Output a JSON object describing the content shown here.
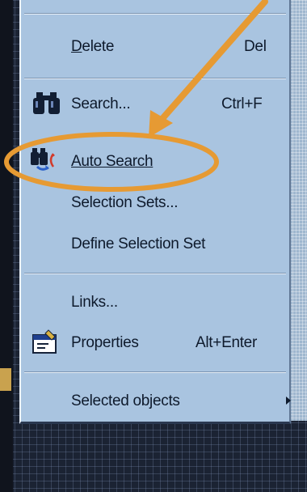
{
  "menu": {
    "items": [
      {
        "label_ul": "D",
        "label_rest": "elete",
        "shortcut": "Del"
      },
      {
        "label_ul": "",
        "label_rest": "Search...",
        "shortcut": "Ctrl+F",
        "icon": "binoculars-icon"
      },
      {
        "label_ul": "",
        "label_rest": "Auto Search",
        "shortcut": "",
        "icon": "auto-search-icon"
      },
      {
        "label_ul": "",
        "label_rest": "Selection Sets...",
        "shortcut": ""
      },
      {
        "label_ul": "",
        "label_rest": "Define Selection Set",
        "shortcut": ""
      },
      {
        "label_ul": "",
        "label_rest": "Links...",
        "shortcut": ""
      },
      {
        "label_ul": "",
        "label_rest": "Properties",
        "shortcut": "Alt+Enter",
        "icon": "properties-icon"
      },
      {
        "label_ul": "",
        "label_rest": "Selected objects",
        "shortcut": "",
        "submenu": true
      }
    ]
  },
  "annotation": {
    "arrow_color": "#e69a33",
    "highlight_color": "#e69a33"
  }
}
